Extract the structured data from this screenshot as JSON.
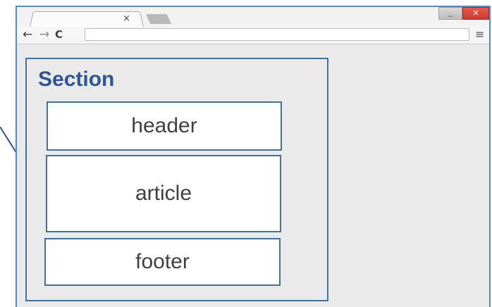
{
  "browser": {
    "tab_close_glyph": "×",
    "minimize_glyph": "_",
    "close_glyph": "×",
    "back_glyph": "←",
    "forward_glyph": "→",
    "reload_glyph": "C",
    "menu_glyph": "≡",
    "address_value": ""
  },
  "diagram": {
    "section_label": "Section",
    "header_label": "header",
    "article_label": "article",
    "footer_label": "footer"
  }
}
